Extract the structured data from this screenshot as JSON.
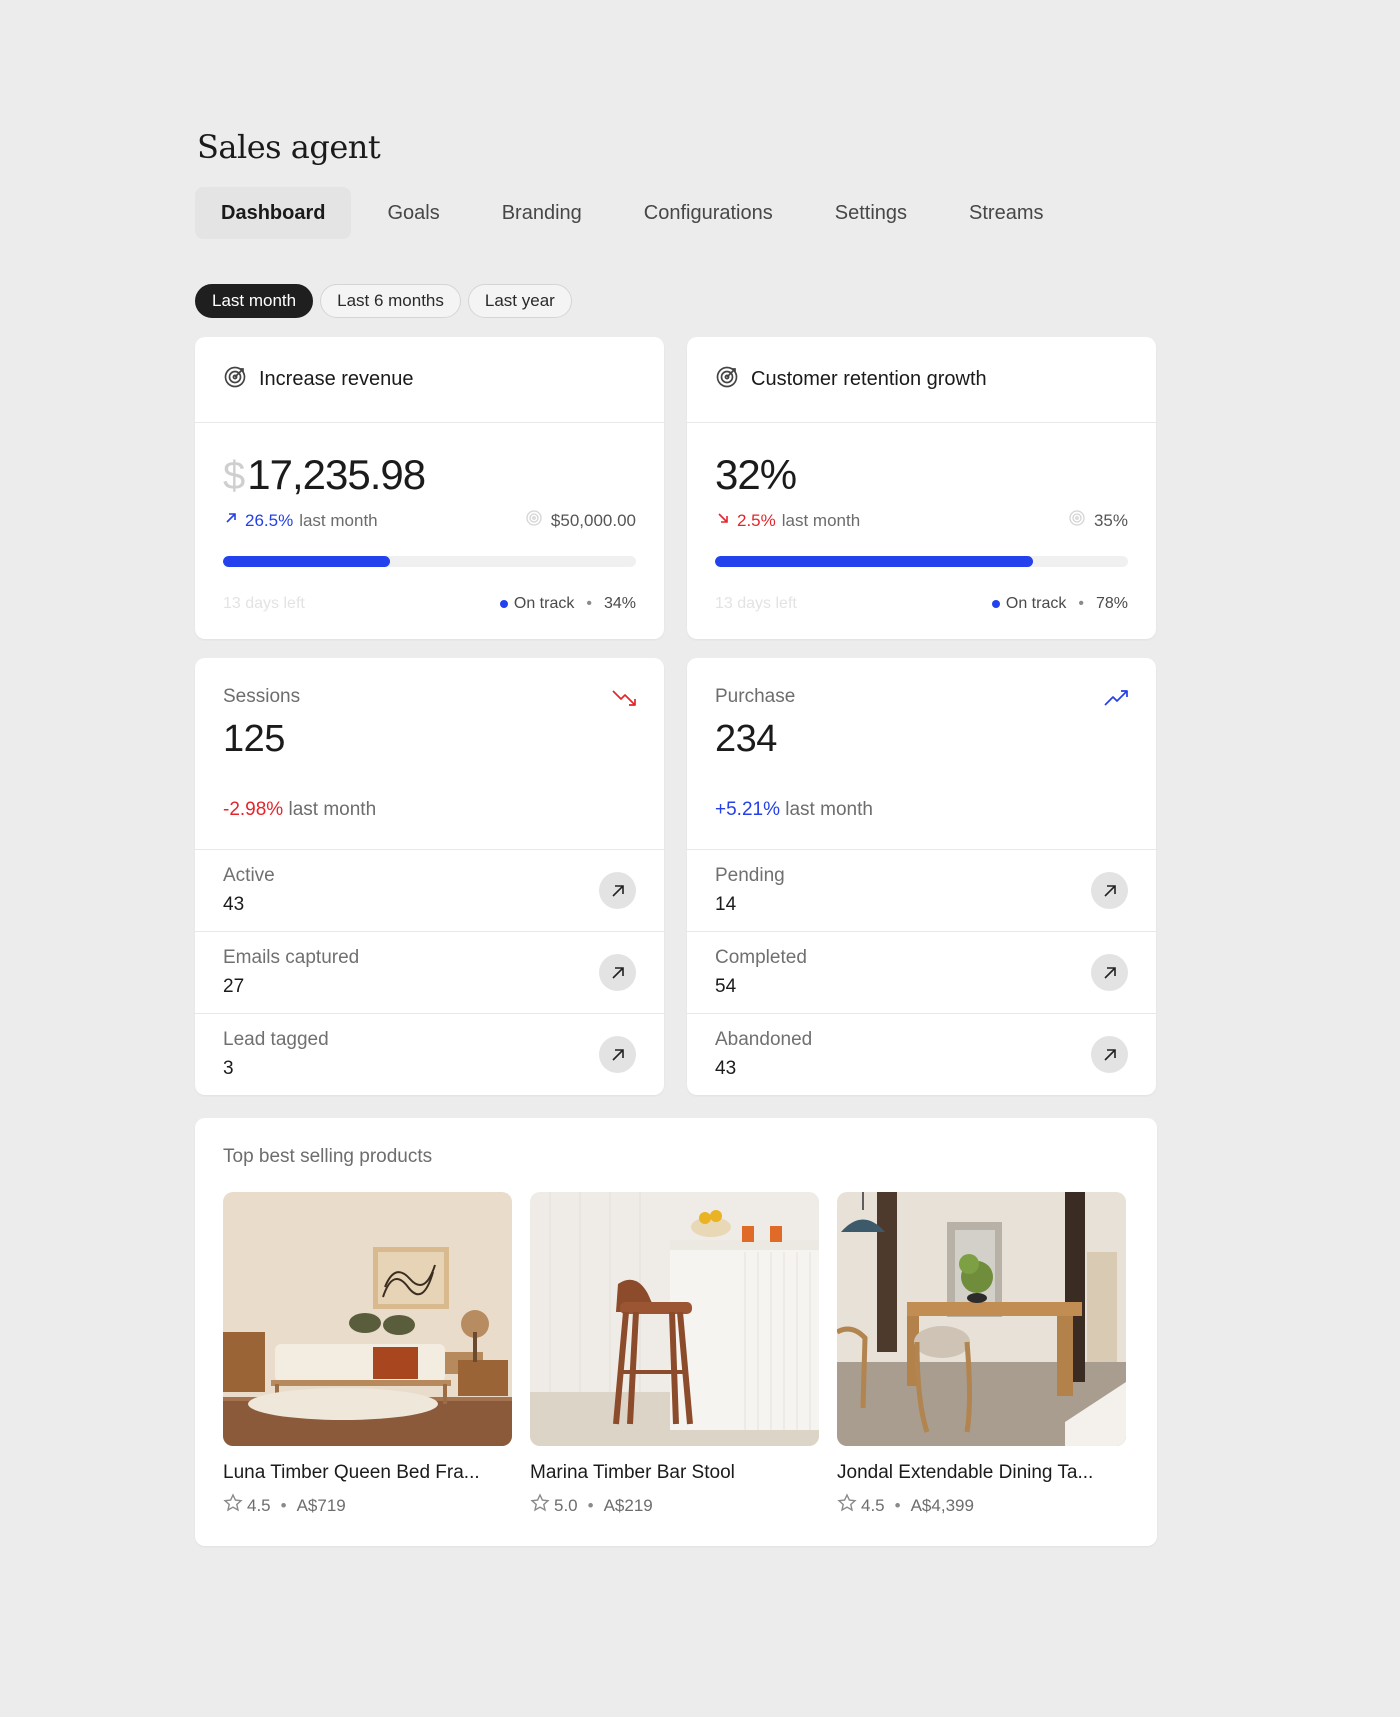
{
  "app": {
    "title": "Sales agent"
  },
  "tabs": [
    {
      "label": "Dashboard",
      "active": true
    },
    {
      "label": "Goals"
    },
    {
      "label": "Branding"
    },
    {
      "label": "Configurations"
    },
    {
      "label": "Settings"
    },
    {
      "label": "Streams"
    }
  ],
  "filters": [
    {
      "label": "Last month",
      "active": true
    },
    {
      "label": "Last 6 months"
    },
    {
      "label": "Last year"
    }
  ],
  "goals": [
    {
      "title": "Increase revenue",
      "currency": "$",
      "value": "17,235.98",
      "change": "26.5%",
      "change_label": "last month",
      "direction": "up",
      "target": "$50,000.00",
      "progress": 0.405,
      "days_left": "13 days left",
      "status": "On track",
      "percent": "34%"
    },
    {
      "title": "Customer retention growth",
      "currency": "",
      "value": "32%",
      "change": "2.5%",
      "change_label": "last month",
      "direction": "down",
      "target": "35%",
      "progress": 0.77,
      "days_left": "13 days left",
      "status": "On track",
      "percent": "78%"
    }
  ],
  "metrics": [
    {
      "label": "Sessions",
      "value": "125",
      "change": "-2.98%",
      "change_label": "last month",
      "trend": "down",
      "rows": [
        {
          "label": "Active",
          "value": "43"
        },
        {
          "label": "Emails captured",
          "value": "27"
        },
        {
          "label": "Lead tagged",
          "value": "3"
        }
      ]
    },
    {
      "label": "Purchase",
      "value": "234",
      "change": "+5.21%",
      "change_label": "last month",
      "trend": "up",
      "rows": [
        {
          "label": "Pending",
          "value": "14"
        },
        {
          "label": "Completed",
          "value": "54"
        },
        {
          "label": "Abandoned",
          "value": "43"
        }
      ]
    }
  ],
  "products": {
    "title": "Top best selling products",
    "items": [
      {
        "name": "Luna Timber Queen Bed Fra...",
        "rating": "4.5",
        "price": "A$719"
      },
      {
        "name": "Marina Timber Bar Stool",
        "rating": "5.0",
        "price": "A$219"
      },
      {
        "name": "Jondal Extendable Dining Ta...",
        "rating": "4.5",
        "price": "A$4,399"
      }
    ]
  },
  "colors": {
    "accent": "#2342ee",
    "positive": "#2440e6",
    "negative": "#e2262b",
    "background": "#edecec"
  },
  "icons": [
    "target-icon",
    "arrow-up-right-icon",
    "arrow-down-right-icon",
    "trending-down-icon",
    "trending-up-icon",
    "star-icon"
  ]
}
